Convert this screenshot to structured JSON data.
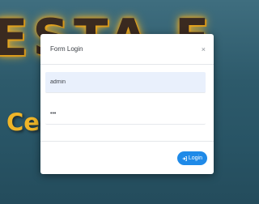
{
  "background": {
    "title": "ESTA F",
    "subtitle": "Ce          abup"
  },
  "login_modal": {
    "title": "Form Login",
    "close_symbol": "×",
    "username_value": "admin",
    "password_value": "•••",
    "login_label": "Login",
    "login_icon": "sign-in-icon"
  },
  "colors": {
    "accent": "#1f8ae8",
    "background": "#2d5a6b",
    "title_glow": "#f1b72e"
  }
}
